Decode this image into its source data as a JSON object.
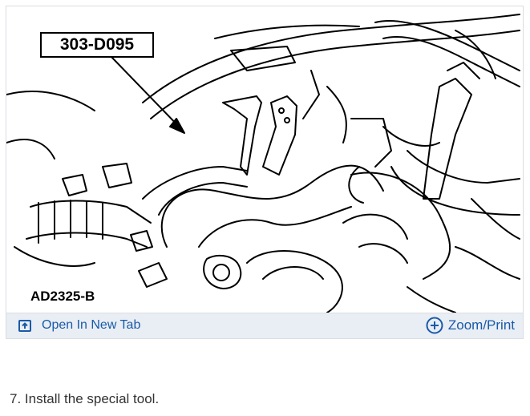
{
  "figure": {
    "callout_label": "303-D095",
    "figure_code": "AD2325-B"
  },
  "toolbar": {
    "open_tab_label": "Open In New Tab",
    "open_tab_icon": "open-in-new-tab-icon",
    "zoom_label": "Zoom/Print",
    "zoom_icon": "plus-circle-icon",
    "accent_color": "#1a5aa6",
    "bar_color": "#e9eef5"
  },
  "step": {
    "text": "7. Install the special tool."
  }
}
